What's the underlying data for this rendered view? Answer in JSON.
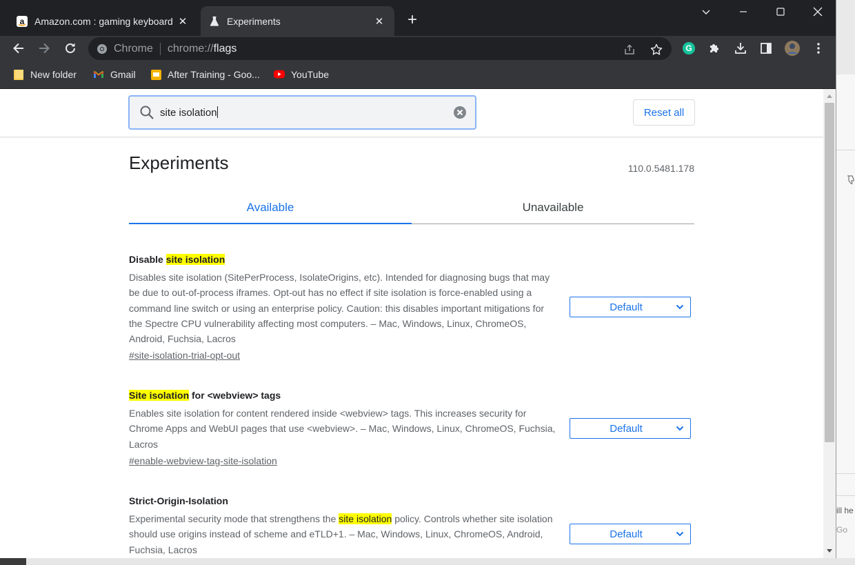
{
  "tabs": [
    {
      "title": "Amazon.com : gaming keyboard",
      "icon": "amazon-icon",
      "close": "✕"
    },
    {
      "title": "Experiments",
      "icon": "flask-icon",
      "close": "✕"
    }
  ],
  "new_tab": "+",
  "omnibox": {
    "chip": "Chrome",
    "url_scheme": "chrome://",
    "url_host": "flags"
  },
  "bookmarks": [
    {
      "label": "New folder",
      "icon": "folder-icon"
    },
    {
      "label": "Gmail",
      "icon": "gmail-icon"
    },
    {
      "label": "After Training - Goo...",
      "icon": "slides-icon"
    },
    {
      "label": "YouTube",
      "icon": "youtube-icon"
    }
  ],
  "search": {
    "value": "site isolation"
  },
  "reset_all": "Reset all",
  "heading": "Experiments",
  "version": "110.0.5481.178",
  "page_tabs": {
    "available": "Available",
    "unavailable": "Unavailable"
  },
  "flags": [
    {
      "name_pre": "Disable ",
      "name_hl": "site isolation",
      "name_post": "",
      "desc_pre": "Disables site isolation (SitePerProcess, IsolateOrigins, etc). Intended for diagnosing bugs that may be due to out-of-process iframes. Opt-out has no effect if site isolation is force-enabled using a command line switch or using an enterprise policy. Caution: this disables important mitigations for the Spectre CPU vulnerability affecting most computers. – Mac, Windows, Linux, ChromeOS, Android, Fuchsia, Lacros",
      "desc_hl": "",
      "desc_post": "",
      "link": "#site-isolation-trial-opt-out",
      "value": "Default"
    },
    {
      "name_pre": "",
      "name_hl": "Site isolation",
      "name_post": " for <webview> tags",
      "desc_pre": "Enables site isolation for content rendered inside <webview> tags. This increases security for Chrome Apps and WebUI pages that use <webview>. – Mac, Windows, Linux, ChromeOS, Fuchsia, Lacros",
      "desc_hl": "",
      "desc_post": "",
      "link": "#enable-webview-tag-site-isolation",
      "value": "Default"
    },
    {
      "name_pre": "Strict-Origin-Isolation",
      "name_hl": "",
      "name_post": "",
      "desc_pre": "Experimental security mode that strengthens the ",
      "desc_hl": "site isolation",
      "desc_post": " policy. Controls whether site isolation should use origins instead of scheme and eTLD+1. – Mac, Windows, Linux, ChromeOS, Android, Fuchsia, Lacros",
      "link": "",
      "value": "Default"
    }
  ],
  "background_window": {
    "text_1": "ill he",
    "text_2": "Go"
  },
  "colors": {
    "accent": "#1a73e8",
    "highlight": "#ffff00",
    "frame": "#202124",
    "toolbar": "#35363a"
  }
}
